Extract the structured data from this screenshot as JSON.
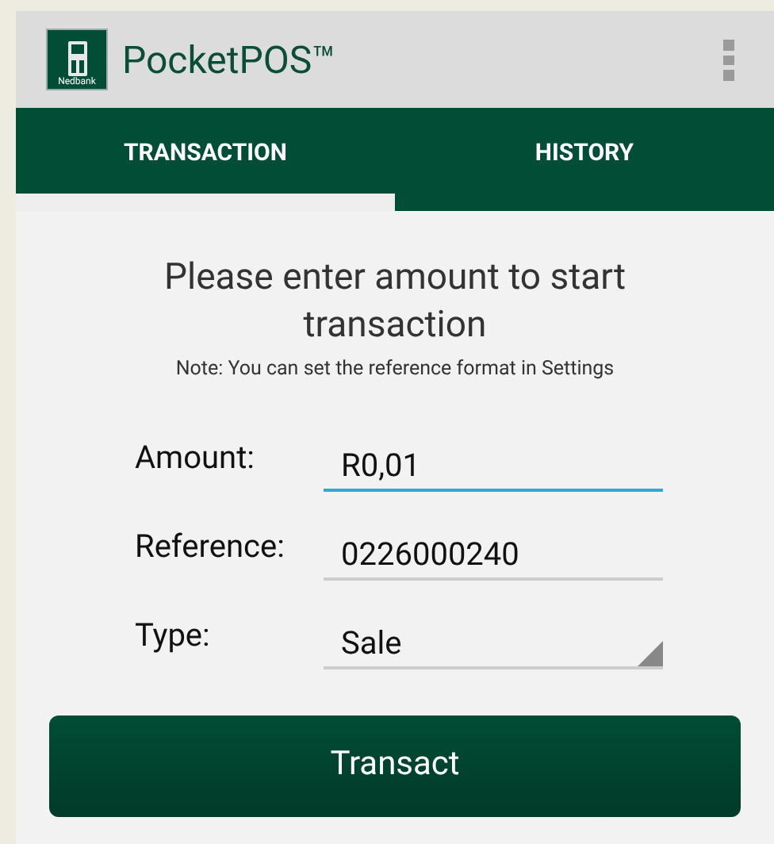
{
  "app_bar": {
    "logo_text": "Nedbank",
    "title": "PocketPOS™"
  },
  "tabs": [
    {
      "label": "TRANSACTION",
      "selected": true
    },
    {
      "label": "HISTORY",
      "selected": false
    }
  ],
  "heading": "Please enter amount to start transaction",
  "note": "Note: You can set the reference format in Settings",
  "fields": [
    {
      "kind": "text",
      "label": "Amount:",
      "value": "R0,01",
      "focused": true
    },
    {
      "kind": "text",
      "label": "Reference:",
      "value": "0226000240",
      "focused": false
    },
    {
      "kind": "select",
      "label": "Type:",
      "value": "Sale",
      "focused": false
    }
  ],
  "button": "Transact"
}
